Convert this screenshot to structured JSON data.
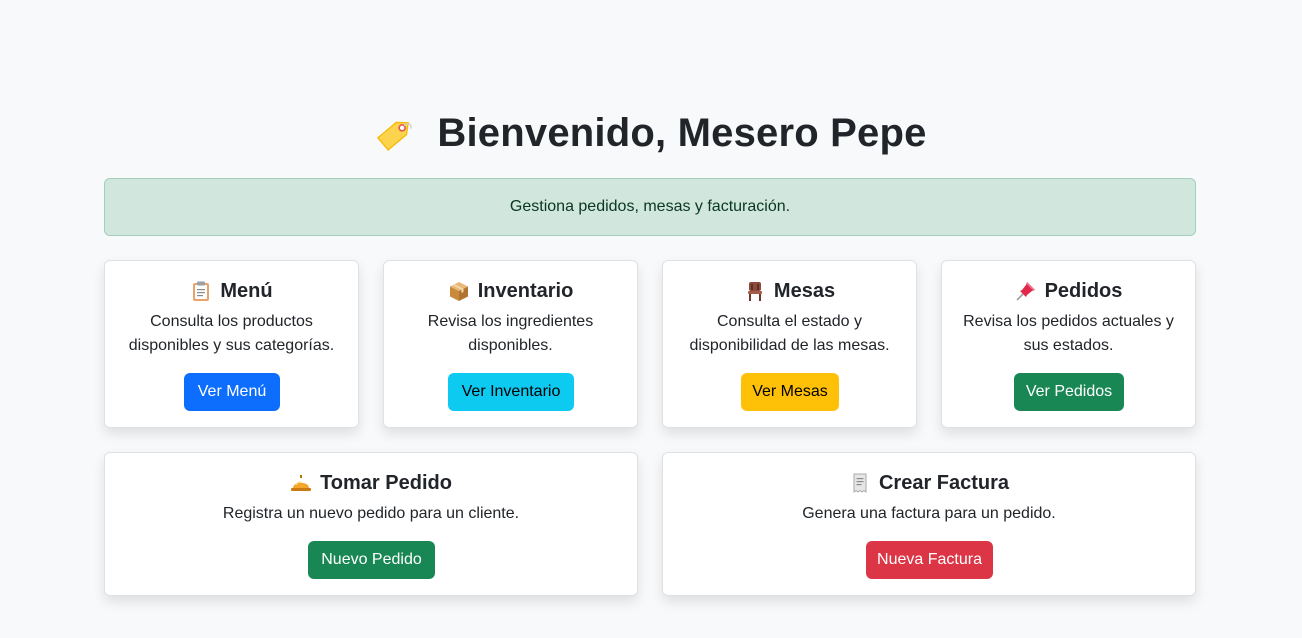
{
  "header": {
    "title": "Bienvenido, Mesero Pepe",
    "icon": "tag-icon"
  },
  "alert": {
    "text": "Gestiona pedidos, mesas y facturación.",
    "color": "#d1e7dd"
  },
  "cards": {
    "menu": {
      "icon": "clipboard-icon",
      "title": "Menú",
      "desc_line1": "Consulta los productos",
      "desc_line2": "disponibles y sus categorías.",
      "button": "Ver Menú",
      "button_color": "#0d6efd"
    },
    "inventario": {
      "icon": "package-icon",
      "title": "Inventario",
      "desc_line1": "Revisa los ingredientes",
      "desc_line2": "disponibles.",
      "button": "Ver Inventario",
      "button_color": "#0dcaf0"
    },
    "mesas": {
      "icon": "chair-icon",
      "title": "Mesas",
      "desc_line1": "Consulta el estado y",
      "desc_line2": "disponibilidad de las mesas.",
      "button": "Ver Mesas",
      "button_color": "#ffc107"
    },
    "pedidos": {
      "icon": "pushpin-icon",
      "title": "Pedidos",
      "desc_line1": "Revisa los pedidos actuales y",
      "desc_line2": "sus estados.",
      "button": "Ver Pedidos",
      "button_color": "#198754"
    },
    "tomar_pedido": {
      "icon": "bellhop-bell-icon",
      "title": "Tomar Pedido",
      "desc": "Registra un nuevo pedido para un cliente.",
      "button": "Nuevo Pedido",
      "button_color": "#198754"
    },
    "crear_factura": {
      "icon": "receipt-icon",
      "title": "Crear Factura",
      "desc": "Genera una factura para un pedido.",
      "button": "Nueva Factura",
      "button_color": "#dc3545"
    }
  }
}
